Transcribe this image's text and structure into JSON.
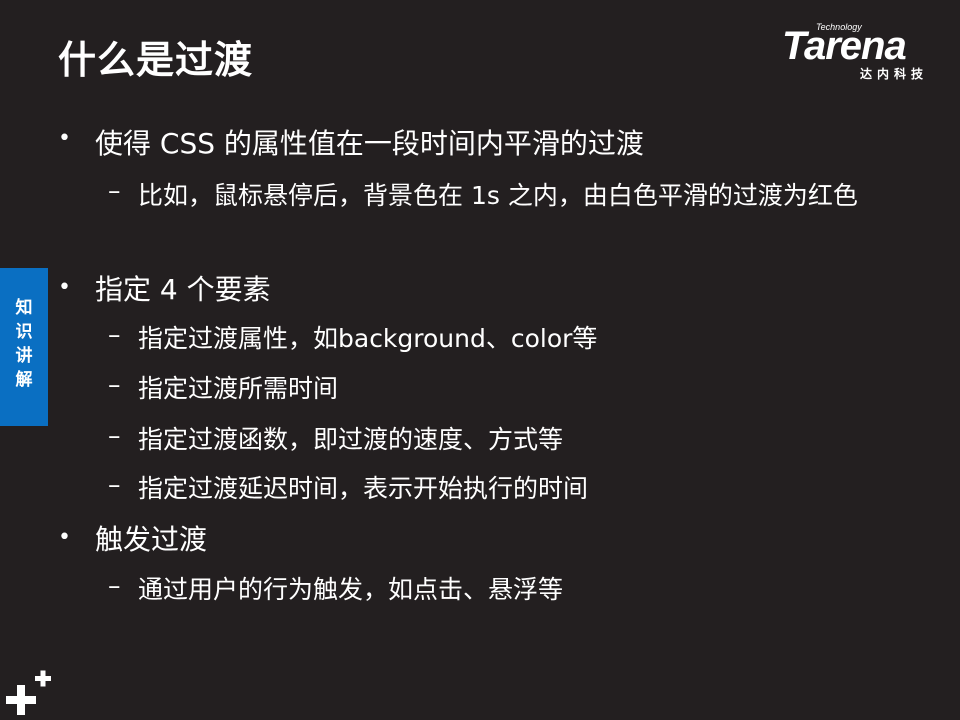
{
  "slide": {
    "title": "什么是过渡",
    "side_tab": "知识讲解",
    "logo": {
      "brand": "Tarena",
      "tagline": "Technology",
      "cn_name": "达内科技"
    },
    "bullet_symbol": "•",
    "dash_symbol": "–",
    "points": [
      {
        "text": "使得 CSS 的属性值在一段时间内平滑的过渡",
        "subs": [
          "比如，鼠标悬停后，背景色在 1s 之内，由白色平滑的过渡为红色"
        ]
      },
      {
        "text": "指定 4 个要素",
        "subs": [
          "指定过渡属性，如background、color等",
          "指定过渡所需时间",
          "指定过渡函数，即过渡的速度、方式等",
          "指定过渡延迟时间，表示开始执行的时间"
        ]
      },
      {
        "text": "触发过渡",
        "subs": [
          "通过用户的行为触发，如点击、悬浮等"
        ]
      }
    ]
  },
  "colors": {
    "background": "#231f20",
    "text": "#ffffff",
    "accent": "#0a6fc2"
  }
}
